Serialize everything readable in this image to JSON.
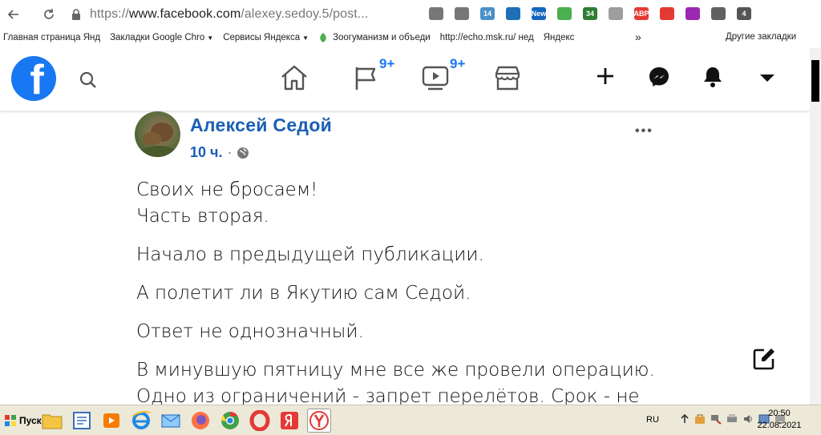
{
  "browser": {
    "url_prefix": "https://",
    "url_host": "www.facebook.com",
    "url_path": "/alexey.sedoy.5/post...",
    "extensions": [
      {
        "name": "chat-icon",
        "color": "#777777",
        "label": ""
      },
      {
        "name": "bookmark-icon",
        "color": "#777777",
        "label": ""
      },
      {
        "name": "calendar-icon",
        "color": "#4a90c8",
        "label": "14"
      },
      {
        "name": "cloud-icon",
        "color": "#1e6fb8",
        "label": ""
      },
      {
        "name": "news-icon",
        "color": "#1565c0",
        "label": "New"
      },
      {
        "name": "download-arrow-icon",
        "color": "#4caf50",
        "label": ""
      },
      {
        "name": "counter-icon",
        "color": "#2e7d32",
        "label": "34"
      },
      {
        "name": "globe-icon",
        "color": "#9e9e9e",
        "label": ""
      },
      {
        "name": "adblock-icon",
        "color": "#e53935",
        "label": "ABP"
      },
      {
        "name": "stop-hand-icon",
        "color": "#e53935",
        "label": ""
      },
      {
        "name": "feather-icon",
        "color": "#9c27b0",
        "label": ""
      },
      {
        "name": "bulb-icon",
        "color": "#616161",
        "label": ""
      },
      {
        "name": "downloads-icon",
        "color": "#555555",
        "label": "4"
      }
    ]
  },
  "bookmarks": [
    {
      "label": "Главная страница Янд",
      "dropdown": false,
      "icon": "none"
    },
    {
      "label": "Закладки Google Chro",
      "dropdown": true,
      "icon": "none"
    },
    {
      "label": "Сервисы Яндекса",
      "dropdown": true,
      "icon": "none"
    },
    {
      "label": "Зоогуманизм и объеди",
      "dropdown": false,
      "icon": "leaf"
    },
    {
      "label": "http://echo.msk.ru/ нед",
      "dropdown": false,
      "icon": "none"
    },
    {
      "label": "Яндекс",
      "dropdown": false,
      "icon": "none"
    }
  ],
  "bookmarks_more": "»",
  "bookmarks_other": "Другие закладки",
  "fb": {
    "logo_letter": "f",
    "groups_badge": "9+",
    "watch_badge": "9+",
    "brand_color": "#1877f2"
  },
  "post": {
    "author": "Алексей Седой",
    "time": "10 ч.",
    "separator": "·",
    "more_label": "•••",
    "paragraphs": [
      [
        "Своих не бросаем!",
        "Часть вторая."
      ],
      [
        "Начало в предыдущей публикации."
      ],
      [
        "А полетит ли в Якутию сам Седой."
      ],
      [
        "Ответ не однозначный."
      ],
      [
        "В минувшую пятницу мне все же провели операцию.",
        "Одно из ограничений - запрет перелётов. Срок - не"
      ]
    ]
  },
  "taskbar": {
    "start_label": "Пуск",
    "lang": "RU",
    "time": "20:50",
    "date": "22.08.2021"
  }
}
